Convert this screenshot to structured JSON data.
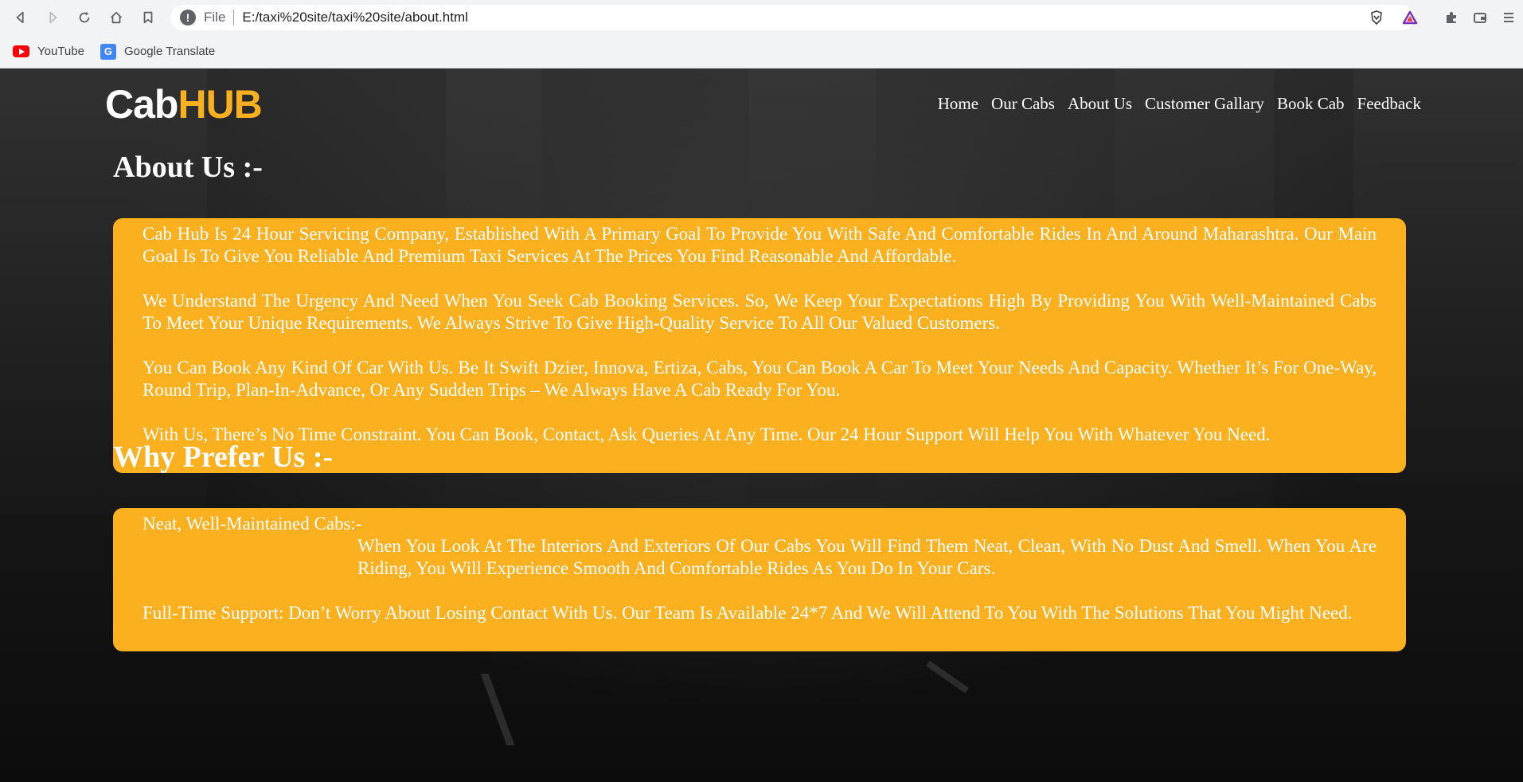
{
  "browser": {
    "scheme": "File",
    "url": "E:/taxi%20site/taxi%20site/about.html",
    "bookmarks": [
      {
        "label": "YouTube",
        "icon": "youtube-icon"
      },
      {
        "label": "Google Translate",
        "icon": "google-translate-icon"
      }
    ]
  },
  "site": {
    "logo_part1": "Cab",
    "logo_part2": "HUB",
    "nav": [
      "Home",
      "Our Cabs",
      "About Us",
      "Customer Gallary",
      "Book Cab",
      "Feedback"
    ]
  },
  "about": {
    "title": "About Us :-",
    "paragraphs": [
      "Cab Hub Is 24 Hour Servicing Company, Established With A Primary Goal To Provide You With Safe And Comfortable Rides In And Around Maharashtra. Our Main Goal Is To Give You Reliable And Premium Taxi Services At The Prices You Find Reasonable And Affordable.",
      "We Understand The Urgency And Need When You Seek Cab Booking Services. So, We Keep Your Expectations High By Providing You With Well-Maintained Cabs To Meet Your Unique Requirements. We Always Strive To Give High-Quality Service To All Our Valued Customers.",
      "You Can Book Any Kind Of Car With Us. Be It Swift Dzier, Innova, Ertiza, Cabs, You Can Book A Car To Meet Your Needs And Capacity. Whether It’s For One-Way, Round Trip, Plan-In-Advance, Or Any Sudden Trips – We Always Have A Cab Ready For You.",
      "With Us, There’s No Time Constraint. You Can Book, Contact, Ask Queries At Any Time. Our 24 Hour Support Will Help You With Whatever You Need."
    ]
  },
  "why": {
    "title": "Why Prefer Us :-",
    "item1_heading": "Neat, Well-Maintained Cabs:-",
    "item1_text": "When You Look At The Interiors And Exteriors Of Our Cabs You Will Find Them Neat, Clean, With No Dust And Smell. When You Are Riding, You Will Experience Smooth And Comfortable Rides As You Do In Your Cars.",
    "item2_text": "Full-Time Support: Don’t Worry About Losing Contact With Us. Our Team Is Available 24*7 And We Will Attend To You With The Solutions That You Might Need."
  },
  "colors": {
    "accent": "#fbb01f",
    "text": "#ffffff"
  }
}
